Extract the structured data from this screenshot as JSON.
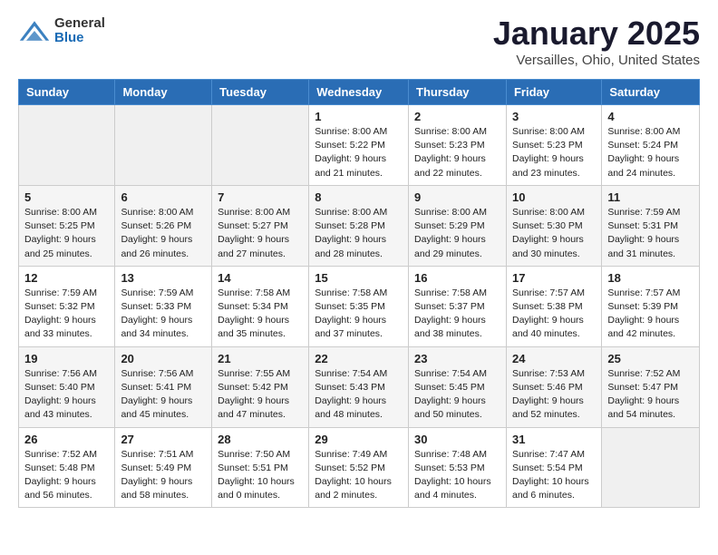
{
  "header": {
    "logo_general": "General",
    "logo_blue": "Blue",
    "title": "January 2025",
    "subtitle": "Versailles, Ohio, United States"
  },
  "days_of_week": [
    "Sunday",
    "Monday",
    "Tuesday",
    "Wednesday",
    "Thursday",
    "Friday",
    "Saturday"
  ],
  "weeks": [
    [
      {
        "day": "",
        "info": ""
      },
      {
        "day": "",
        "info": ""
      },
      {
        "day": "",
        "info": ""
      },
      {
        "day": "1",
        "info": "Sunrise: 8:00 AM\nSunset: 5:22 PM\nDaylight: 9 hours and 21 minutes."
      },
      {
        "day": "2",
        "info": "Sunrise: 8:00 AM\nSunset: 5:23 PM\nDaylight: 9 hours and 22 minutes."
      },
      {
        "day": "3",
        "info": "Sunrise: 8:00 AM\nSunset: 5:23 PM\nDaylight: 9 hours and 23 minutes."
      },
      {
        "day": "4",
        "info": "Sunrise: 8:00 AM\nSunset: 5:24 PM\nDaylight: 9 hours and 24 minutes."
      }
    ],
    [
      {
        "day": "5",
        "info": "Sunrise: 8:00 AM\nSunset: 5:25 PM\nDaylight: 9 hours and 25 minutes."
      },
      {
        "day": "6",
        "info": "Sunrise: 8:00 AM\nSunset: 5:26 PM\nDaylight: 9 hours and 26 minutes."
      },
      {
        "day": "7",
        "info": "Sunrise: 8:00 AM\nSunset: 5:27 PM\nDaylight: 9 hours and 27 minutes."
      },
      {
        "day": "8",
        "info": "Sunrise: 8:00 AM\nSunset: 5:28 PM\nDaylight: 9 hours and 28 minutes."
      },
      {
        "day": "9",
        "info": "Sunrise: 8:00 AM\nSunset: 5:29 PM\nDaylight: 9 hours and 29 minutes."
      },
      {
        "day": "10",
        "info": "Sunrise: 8:00 AM\nSunset: 5:30 PM\nDaylight: 9 hours and 30 minutes."
      },
      {
        "day": "11",
        "info": "Sunrise: 7:59 AM\nSunset: 5:31 PM\nDaylight: 9 hours and 31 minutes."
      }
    ],
    [
      {
        "day": "12",
        "info": "Sunrise: 7:59 AM\nSunset: 5:32 PM\nDaylight: 9 hours and 33 minutes."
      },
      {
        "day": "13",
        "info": "Sunrise: 7:59 AM\nSunset: 5:33 PM\nDaylight: 9 hours and 34 minutes."
      },
      {
        "day": "14",
        "info": "Sunrise: 7:58 AM\nSunset: 5:34 PM\nDaylight: 9 hours and 35 minutes."
      },
      {
        "day": "15",
        "info": "Sunrise: 7:58 AM\nSunset: 5:35 PM\nDaylight: 9 hours and 37 minutes."
      },
      {
        "day": "16",
        "info": "Sunrise: 7:58 AM\nSunset: 5:37 PM\nDaylight: 9 hours and 38 minutes."
      },
      {
        "day": "17",
        "info": "Sunrise: 7:57 AM\nSunset: 5:38 PM\nDaylight: 9 hours and 40 minutes."
      },
      {
        "day": "18",
        "info": "Sunrise: 7:57 AM\nSunset: 5:39 PM\nDaylight: 9 hours and 42 minutes."
      }
    ],
    [
      {
        "day": "19",
        "info": "Sunrise: 7:56 AM\nSunset: 5:40 PM\nDaylight: 9 hours and 43 minutes."
      },
      {
        "day": "20",
        "info": "Sunrise: 7:56 AM\nSunset: 5:41 PM\nDaylight: 9 hours and 45 minutes."
      },
      {
        "day": "21",
        "info": "Sunrise: 7:55 AM\nSunset: 5:42 PM\nDaylight: 9 hours and 47 minutes."
      },
      {
        "day": "22",
        "info": "Sunrise: 7:54 AM\nSunset: 5:43 PM\nDaylight: 9 hours and 48 minutes."
      },
      {
        "day": "23",
        "info": "Sunrise: 7:54 AM\nSunset: 5:45 PM\nDaylight: 9 hours and 50 minutes."
      },
      {
        "day": "24",
        "info": "Sunrise: 7:53 AM\nSunset: 5:46 PM\nDaylight: 9 hours and 52 minutes."
      },
      {
        "day": "25",
        "info": "Sunrise: 7:52 AM\nSunset: 5:47 PM\nDaylight: 9 hours and 54 minutes."
      }
    ],
    [
      {
        "day": "26",
        "info": "Sunrise: 7:52 AM\nSunset: 5:48 PM\nDaylight: 9 hours and 56 minutes."
      },
      {
        "day": "27",
        "info": "Sunrise: 7:51 AM\nSunset: 5:49 PM\nDaylight: 9 hours and 58 minutes."
      },
      {
        "day": "28",
        "info": "Sunrise: 7:50 AM\nSunset: 5:51 PM\nDaylight: 10 hours and 0 minutes."
      },
      {
        "day": "29",
        "info": "Sunrise: 7:49 AM\nSunset: 5:52 PM\nDaylight: 10 hours and 2 minutes."
      },
      {
        "day": "30",
        "info": "Sunrise: 7:48 AM\nSunset: 5:53 PM\nDaylight: 10 hours and 4 minutes."
      },
      {
        "day": "31",
        "info": "Sunrise: 7:47 AM\nSunset: 5:54 PM\nDaylight: 10 hours and 6 minutes."
      },
      {
        "day": "",
        "info": ""
      }
    ]
  ]
}
